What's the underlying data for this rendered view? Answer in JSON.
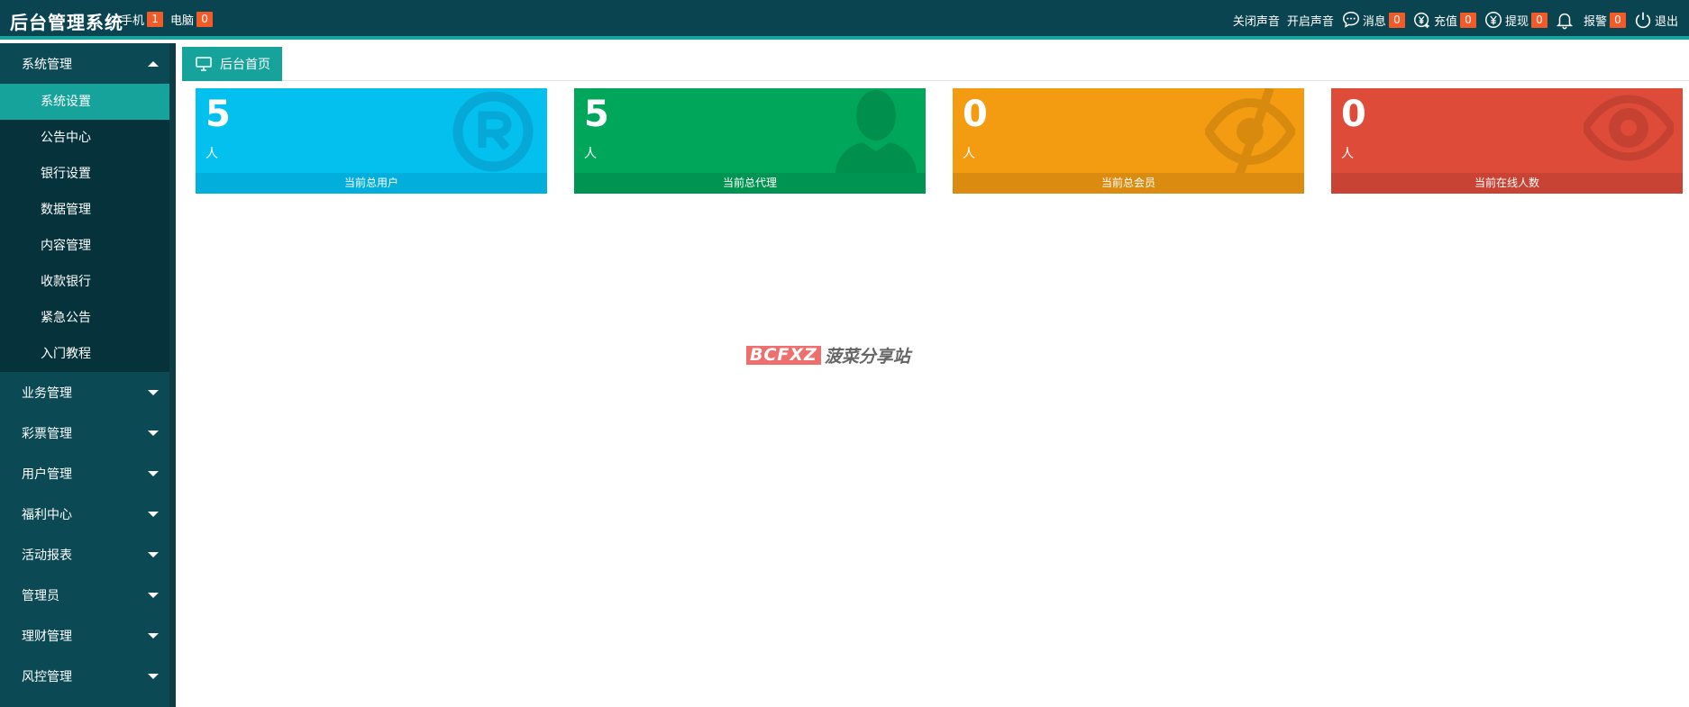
{
  "header": {
    "title": "后台管理系统",
    "phone_label": "手机",
    "phone_count": "1",
    "pc_label": "电脑",
    "pc_count": "0",
    "sound_off": "关闭声音",
    "sound_on": "开启声音",
    "messages_label": "消息",
    "messages_count": "0",
    "recharge_label": "充值",
    "recharge_count": "0",
    "withdraw_label": "提现",
    "withdraw_count": "0",
    "alarm_label": "报警",
    "alarm_count": "0",
    "logout_label": "退出"
  },
  "sidebar": {
    "groups": [
      {
        "label": "系统管理",
        "expanded": true,
        "items": [
          {
            "label": "系统设置",
            "active": true
          },
          {
            "label": "公告中心"
          },
          {
            "label": "银行设置"
          },
          {
            "label": "数据管理"
          },
          {
            "label": "内容管理"
          },
          {
            "label": "收款银行"
          },
          {
            "label": "紧急公告"
          },
          {
            "label": "入门教程"
          }
        ]
      },
      {
        "label": "业务管理"
      },
      {
        "label": "彩票管理"
      },
      {
        "label": "用户管理"
      },
      {
        "label": "福利中心"
      },
      {
        "label": "活动报表"
      },
      {
        "label": "管理员"
      },
      {
        "label": "理财管理"
      },
      {
        "label": "风控管理"
      }
    ]
  },
  "tab": {
    "label": "后台首页"
  },
  "cards": [
    {
      "value": "5",
      "unit": "人",
      "label": "当前总用户",
      "color": "#03c0ef",
      "icon": "registered-icon"
    },
    {
      "value": "5",
      "unit": "人",
      "label": "当前总代理",
      "color": "#00a65a",
      "icon": "user-icon"
    },
    {
      "value": "0",
      "unit": "人",
      "label": "当前总会员",
      "color": "#f39c12",
      "icon": "eye-slash-icon"
    },
    {
      "value": "0",
      "unit": "人",
      "label": "当前在线人数",
      "color": "#de4b39",
      "icon": "eye-icon"
    }
  ],
  "watermark": {
    "box": "BCFXZ",
    "text": "菠菜分享站"
  }
}
